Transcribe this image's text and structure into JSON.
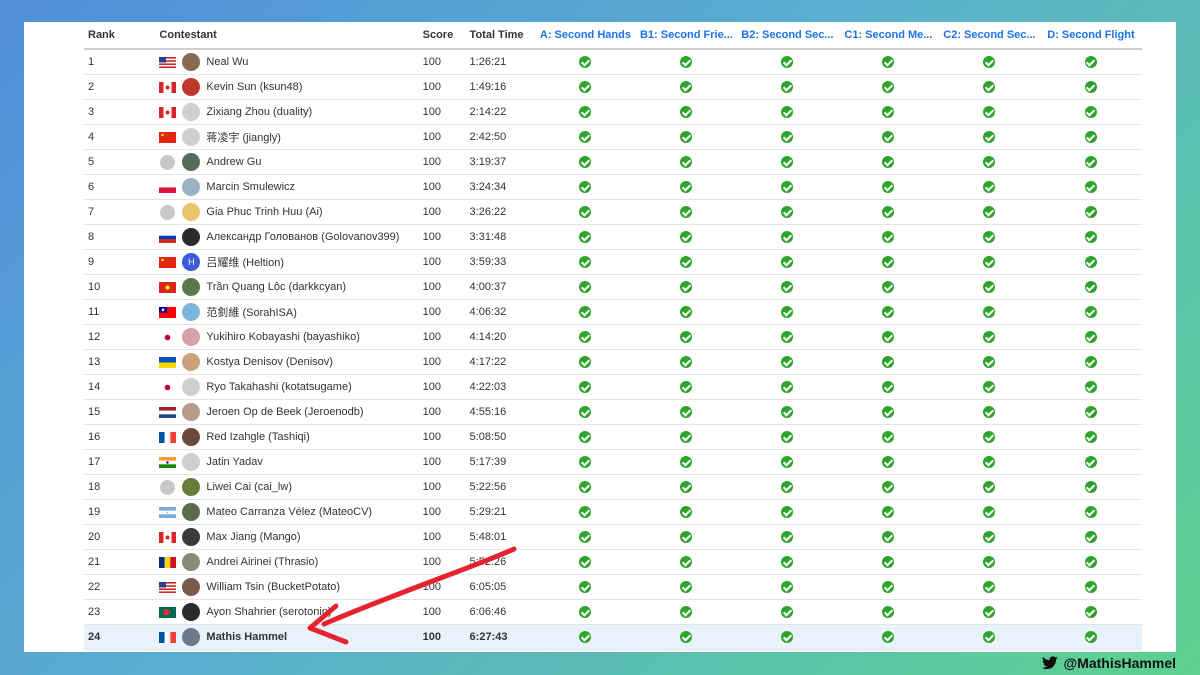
{
  "headers": {
    "rank": "Rank",
    "contestant": "Contestant",
    "score": "Score",
    "time": "Total Time",
    "problems": [
      "A: Second Hands",
      "B1: Second Frie...",
      "B2: Second Sec...",
      "C1: Second Me...",
      "C2: Second Sec...",
      "D: Second Flight"
    ]
  },
  "rows": [
    {
      "rank": "1",
      "name": "Neal Wu",
      "flag": "us",
      "avatar": "#8a6a55",
      "score": "100",
      "time": "1:26:21"
    },
    {
      "rank": "2",
      "name": "Kevin Sun (ksun48)",
      "flag": "ca",
      "avatar": "#c0392b",
      "score": "100",
      "time": "1:49:16"
    },
    {
      "rank": "3",
      "name": "Zixiang Zhou (duality)",
      "flag": "ca",
      "avatar": "#cfcfcf",
      "score": "100",
      "time": "2:14:22"
    },
    {
      "rank": "4",
      "name": "蒋凌宇 (jiangly)",
      "flag": "cn",
      "avatar": "#cfcfcf",
      "score": "100",
      "time": "2:42:50"
    },
    {
      "rank": "5",
      "name": "Andrew Gu",
      "flag": "globe",
      "avatar": "#556b5a",
      "score": "100",
      "time": "3:19:37"
    },
    {
      "rank": "6",
      "name": "Marcin Smulewicz",
      "flag": "pl",
      "avatar": "#9bb0c4",
      "score": "100",
      "time": "3:24:34"
    },
    {
      "rank": "7",
      "name": "Gia Phuc Trinh Huu (Ai)",
      "flag": "globe",
      "avatar": "#e8c46a",
      "score": "100",
      "time": "3:26:22"
    },
    {
      "rank": "8",
      "name": "Александр Голованов (Golovanov399)",
      "flag": "ru",
      "avatar": "#2b2b2b",
      "score": "100",
      "time": "3:31:48"
    },
    {
      "rank": "9",
      "name": "吕耀维 (Heltion)",
      "flag": "cn",
      "avatar": "#3b5bdb",
      "avatar_letter": "H",
      "score": "100",
      "time": "3:59:33"
    },
    {
      "rank": "10",
      "name": "Trần Quang Lộc (darkkcyan)",
      "flag": "vn",
      "avatar": "#5a7a4a",
      "score": "100",
      "time": "4:00:37"
    },
    {
      "rank": "11",
      "name": "范釗維 (SorahISA)",
      "flag": "tw",
      "avatar": "#7fb6e0",
      "score": "100",
      "time": "4:06:32"
    },
    {
      "rank": "12",
      "name": "Yukihiro Kobayashi (bayashiko)",
      "flag": "jp",
      "avatar": "#d9a0a8",
      "score": "100",
      "time": "4:14:20"
    },
    {
      "rank": "13",
      "name": "Kostya Denisov (Denisov)",
      "flag": "ua",
      "avatar": "#c9a27a",
      "score": "100",
      "time": "4:17:22"
    },
    {
      "rank": "14",
      "name": "Ryo Takahashi (kotatsugame)",
      "flag": "jp",
      "avatar": "#cfcfcf",
      "score": "100",
      "time": "4:22:03"
    },
    {
      "rank": "15",
      "name": "Jeroen Op de Beek (Jeroenodb)",
      "flag": "nl",
      "avatar": "#b89a8a",
      "score": "100",
      "time": "4:55:16"
    },
    {
      "rank": "16",
      "name": "Red Izahgle (Tashiqi)",
      "flag": "fr",
      "avatar": "#6b4a3a",
      "score": "100",
      "time": "5:08:50"
    },
    {
      "rank": "17",
      "name": "Jatin Yadav",
      "flag": "in",
      "avatar": "#cfcfcf",
      "score": "100",
      "time": "5:17:39"
    },
    {
      "rank": "18",
      "name": "Liwei Cai (cai_lw)",
      "flag": "globe",
      "avatar": "#6a7a3a",
      "score": "100",
      "time": "5:22:56"
    },
    {
      "rank": "19",
      "name": "Mateo Carranza Vélez (MateoCV)",
      "flag": "ar",
      "avatar": "#5a6a4a",
      "score": "100",
      "time": "5:29:21"
    },
    {
      "rank": "20",
      "name": "Max Jiang (Mango)",
      "flag": "ca",
      "avatar": "#3a3a3a",
      "score": "100",
      "time": "5:48:01"
    },
    {
      "rank": "21",
      "name": "Andrei Airinei (Thrasio)",
      "flag": "ro",
      "avatar": "#8a8a7a",
      "score": "100",
      "time": "5:52:26"
    },
    {
      "rank": "22",
      "name": "William Tsin (BucketPotato)",
      "flag": "us",
      "avatar": "#7a5a4a",
      "score": "100",
      "time": "6:05:05"
    },
    {
      "rank": "23",
      "name": "Ayon Shahrier (serotonin)",
      "flag": "bd",
      "avatar": "#2b2b2b",
      "score": "100",
      "time": "6:06:46"
    },
    {
      "rank": "24",
      "name": "Mathis Hammel",
      "flag": "fr",
      "avatar": "#6a7a8a",
      "score": "100",
      "time": "6:27:43",
      "highlight": true
    }
  ],
  "handle": "@MathisHammel",
  "colors": {
    "check": "#2ea52a",
    "header_link": "#1a73e8",
    "highlight_row": "#e8f2fc",
    "arrow": "#e5232f"
  }
}
